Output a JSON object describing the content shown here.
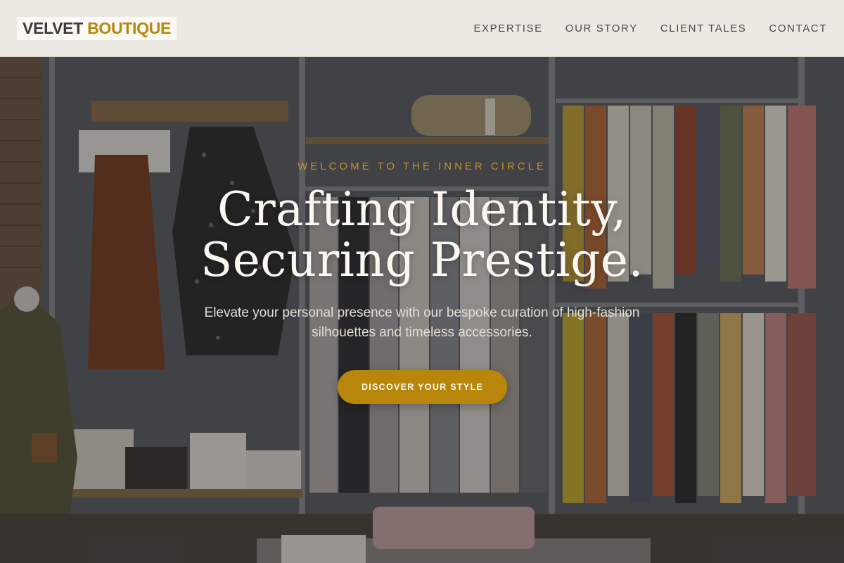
{
  "brand": {
    "word1": "VELVET",
    "word2": "BOUTIQUE",
    "accent_color": "#b8860b"
  },
  "nav": {
    "items": [
      {
        "label": "EXPERTISE"
      },
      {
        "label": "OUR STORY"
      },
      {
        "label": "CLIENT TALES"
      },
      {
        "label": "CONTACT"
      }
    ]
  },
  "hero": {
    "kicker": "WELCOME TO THE INNER CIRCLE",
    "headline_line1": "Crafting Identity,",
    "headline_line2": "Securing Prestige.",
    "subtext": "Elevate your personal presence with our bespoke curation of high-fashion silhouettes and timeless accessories.",
    "cta_label": "DISCOVER YOUR STYLE"
  }
}
